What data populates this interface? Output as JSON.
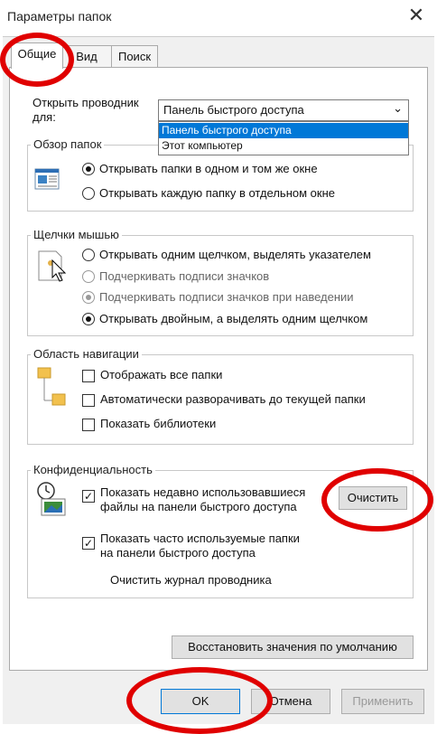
{
  "window": {
    "title": "Параметры папок",
    "close_glyph": "✕"
  },
  "tabs": [
    {
      "label": "Общие"
    },
    {
      "label": "Вид"
    },
    {
      "label": "Поиск"
    }
  ],
  "open_explorer": {
    "label_line1": "Открыть проводник",
    "label_line2": "для:",
    "selected": "Панель быстрого доступа",
    "options": [
      "Панель быстрого доступа",
      "Этот компьютер"
    ]
  },
  "browse_folders": {
    "legend": "Обзор папок",
    "icon": "folder-window-icon",
    "options": [
      "Открывать папки в одном и том же окне",
      "Открывать каждую папку в отдельном окне"
    ],
    "selected_index": 0
  },
  "mouse_clicks": {
    "legend": "Щелчки мышью",
    "icon": "mouse-pointer-icon",
    "options": [
      "Открывать одним щелчком, выделять указателем",
      "Подчеркивать подписи значков",
      "Подчеркивать подписи значков при наведении",
      "Открывать двойным, а выделять одним щелчком"
    ],
    "selected_index": 3
  },
  "navigation": {
    "legend": "Область навигации",
    "icon": "folder-tree-icon",
    "items": [
      {
        "label": "Отображать все папки",
        "checked": false
      },
      {
        "label": "Автоматически разворачивать до текущей папки",
        "checked": false
      },
      {
        "label": "Показать библиотеки",
        "checked": false
      }
    ]
  },
  "privacy": {
    "legend": "Конфиденциальность",
    "icon": "clock-history-icon",
    "recent_line1": "Показать недавно использовавшиеся",
    "recent_line2": "файлы на панели быстрого доступа",
    "frequent_line1": "Показать часто используемые папки",
    "frequent_line2": "на панели быстрого доступа",
    "clear_history_label": "Очистить журнал проводника",
    "clear_button": "Очистить",
    "check_glyph": "✓"
  },
  "restore_button": "Восстановить значения по умолчанию",
  "footer": {
    "ok": "OK",
    "cancel": "Отмена",
    "apply": "Применить"
  },
  "colors": {
    "highlight_ring": "#e00000",
    "selection": "#0078d7"
  }
}
